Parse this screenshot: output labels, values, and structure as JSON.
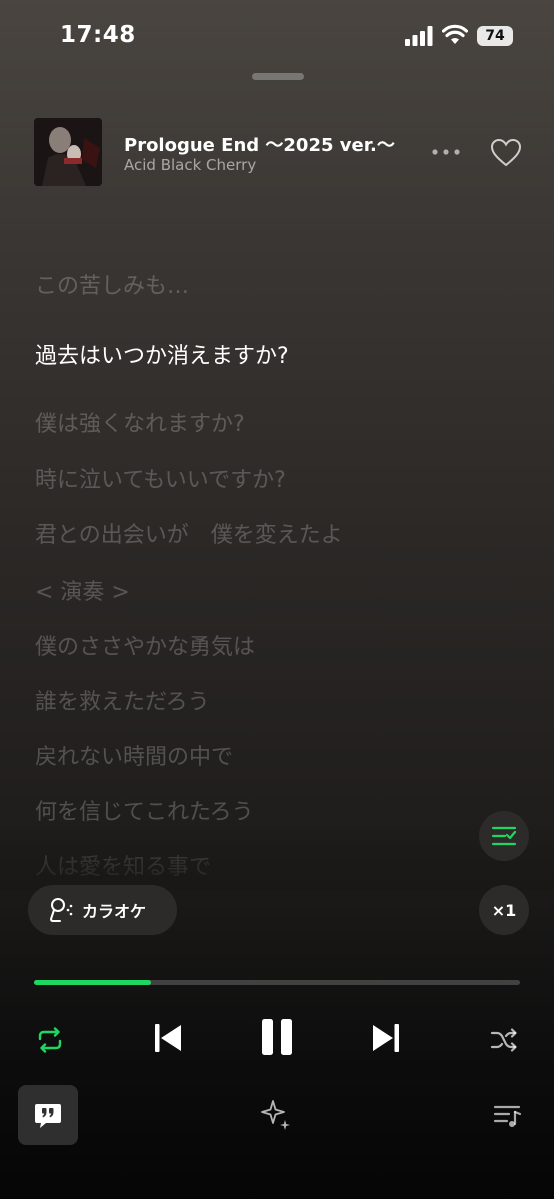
{
  "status": {
    "time": "17:48",
    "battery": "74"
  },
  "song": {
    "title": "Prologue End ～2025 ver.～",
    "artist": "Acid Black Cherry"
  },
  "lyrics": [
    {
      "text": "この苦しみも…",
      "active": false
    },
    {
      "text": "過去はいつか消えますか?",
      "active": true
    },
    {
      "text": "僕は強くなれますか?",
      "active": false
    },
    {
      "text": "時に泣いてもいいですか?",
      "active": false
    },
    {
      "text": "君との出会いが　僕を変えたよ",
      "active": false
    },
    {
      "text": "< 演奏 >",
      "active": false
    },
    {
      "text": "僕のささやかな勇気は",
      "active": false
    },
    {
      "text": "誰を救えただろう",
      "active": false
    },
    {
      "text": "戻れない時間の中で",
      "active": false
    },
    {
      "text": "何を信じてこれたろう",
      "active": false
    },
    {
      "text": "人は愛を知る事で",
      "active": false
    }
  ],
  "karaoke": {
    "label": "カラオケ"
  },
  "speed": {
    "label": "×1"
  },
  "progress": {
    "fraction": 0.24
  },
  "colors": {
    "accent": "#1ed760"
  },
  "icons": {
    "repeat": "repeat-icon",
    "previous": "skip-previous-icon",
    "pause": "pause-icon",
    "next": "skip-next-icon",
    "shuffle": "shuffle-icon",
    "lyrics": "lyrics-icon",
    "sparkle": "sparkle-icon",
    "queue": "queue-icon"
  }
}
